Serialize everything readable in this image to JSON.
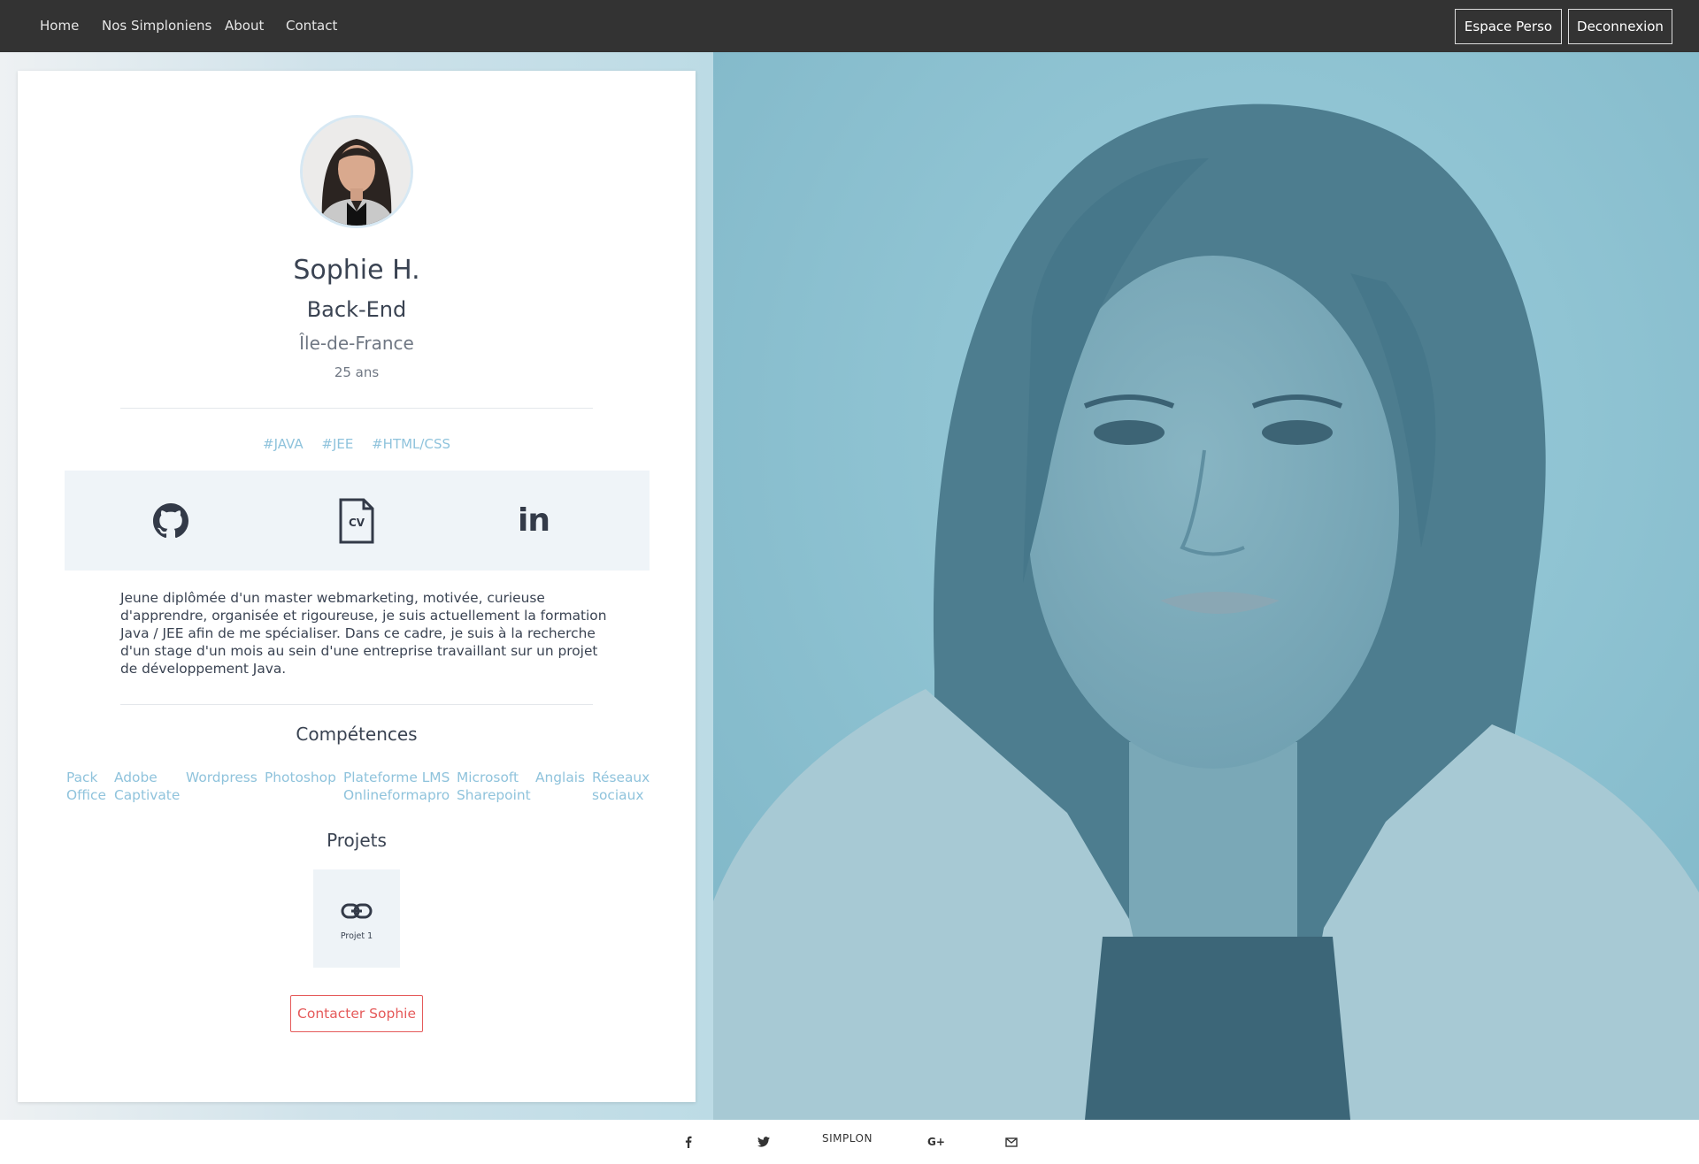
{
  "navbar": {
    "links": [
      "Home",
      "Nos Simploniens",
      "About",
      "Contact"
    ],
    "espace_perso": "Espace Perso",
    "deconnexion": "Deconnexion"
  },
  "profile": {
    "name": "Sophie H.",
    "role": "Back-End",
    "region": "Île-de-France",
    "age": "25 ans",
    "tags": [
      "#JAVA",
      "#JEE",
      "#HTML/CSS"
    ],
    "links": [
      {
        "icon": "github-icon"
      },
      {
        "icon": "cv-file-icon",
        "label": "CV"
      },
      {
        "icon": "linkedin-icon",
        "label": "in"
      }
    ],
    "bio": "Jeune diplômée d'un master webmarketing, motivée, curieuse d'apprendre, organisée et rigoureuse, je suis actuellement la formation Java / JEE afin de me spécialiser. Dans ce cadre, je suis à la recherche d'un stage d'un mois au sein d'une entreprise travaillant sur un projet de développement Java.",
    "competences_title": "Compétences",
    "skills": [
      [
        "Pack",
        "Office"
      ],
      [
        "Adobe",
        "Captivate"
      ],
      [
        "Wordpress"
      ],
      [
        "Photoshop"
      ],
      [
        "Plateforme LMS",
        "Onlineformapro"
      ],
      [
        "Microsoft",
        "Sharepoint"
      ],
      [
        "Anglais"
      ],
      [
        "Réseaux",
        "sociaux"
      ]
    ],
    "projets_title": "Projets",
    "projects": [
      {
        "label": "Projet 1",
        "icon": "link-icon"
      }
    ],
    "contact_button": "Contacter Sophie"
  },
  "footer": {
    "icons": [
      "facebook-icon",
      "twitter-icon",
      "google-plus-icon",
      "mail-icon"
    ],
    "brand": "SIMPLON",
    "brand_accent_color": "#e0245e"
  },
  "colors": {
    "navbar": "#333333",
    "accent": "#8fc3dc",
    "contact_red": "#e55a5a",
    "hero_tint": "#8bc3d3"
  }
}
